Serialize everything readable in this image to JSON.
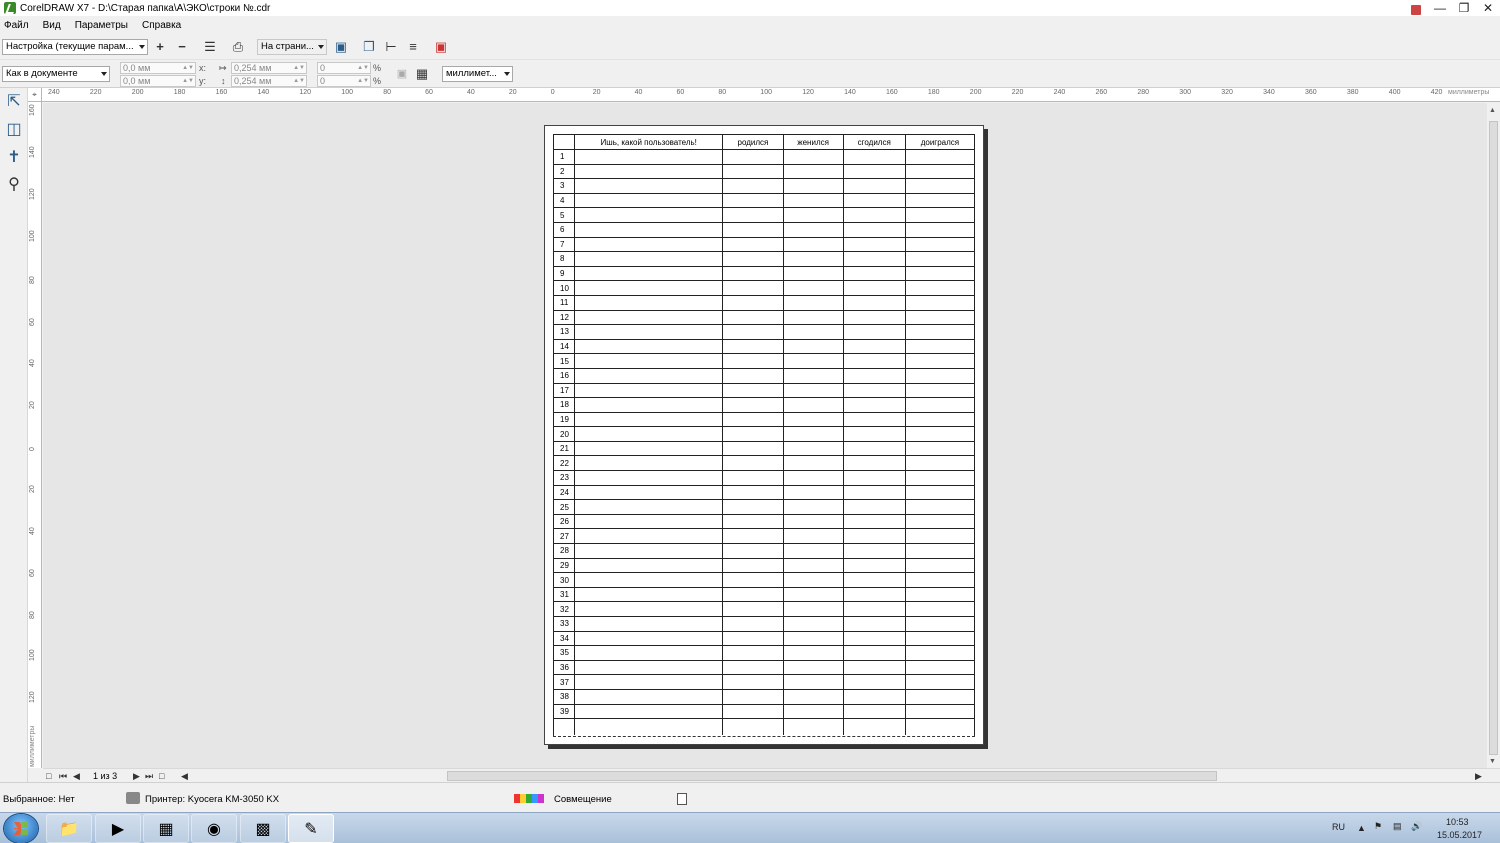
{
  "window": {
    "title": "CorelDRAW X7 - D:\\Старая папка\\А\\ЭКО\\строки №.cdr"
  },
  "menu": {
    "items": [
      "Файл",
      "Вид",
      "Параметры",
      "Справка"
    ]
  },
  "toolbar1": {
    "preset": "Настройка (текущие парам...",
    "page_fit": "На страни..."
  },
  "toolbar2": {
    "orientation": "Как в документе",
    "pos_x": "0,0 мм",
    "pos_y": "0,0 мм",
    "x_label": "x:",
    "y_label": "y:",
    "size_w": "0,254 мм",
    "size_h": "0,254 мм",
    "scale_x": "0",
    "scale_y": "0",
    "percent": "%",
    "units": "миллимет..."
  },
  "ruler": {
    "units_label": "миллиметры",
    "top_ticks": [
      "240",
      "220",
      "200",
      "180",
      "160",
      "140",
      "120",
      "100",
      "80",
      "60",
      "40",
      "20",
      "0",
      "20",
      "40",
      "60",
      "80",
      "100",
      "120",
      "140",
      "160",
      "180",
      "200",
      "220",
      "240",
      "260",
      "280",
      "300",
      "320",
      "340",
      "360",
      "380",
      "400",
      "420"
    ],
    "left_ticks": [
      "160",
      "140",
      "120",
      "100",
      "80",
      "60",
      "40",
      "20",
      "0",
      "20",
      "40",
      "60",
      "80",
      "100",
      "120"
    ]
  },
  "document": {
    "headers": [
      "",
      "Ишь, какой пользователь!",
      "родился",
      "женился",
      "сгодился",
      "доигрался"
    ],
    "row_numbers": [
      "1",
      "2",
      "3",
      "4",
      "5",
      "6",
      "7",
      "8",
      "9",
      "10",
      "11",
      "12",
      "13",
      "14",
      "15",
      "16",
      "17",
      "18",
      "19",
      "20",
      "21",
      "22",
      "23",
      "24",
      "25",
      "26",
      "27",
      "28",
      "29",
      "30",
      "31",
      "32",
      "33",
      "34",
      "35",
      "36",
      "37",
      "38",
      "39"
    ]
  },
  "pager": {
    "page_of": "1 из 3"
  },
  "status": {
    "selection": "Выбранное: Нет",
    "printer": "Принтер: Kyocera KM-3050 KX",
    "overprint": "Совмещение"
  },
  "taskbar": {
    "lang": "RU",
    "time": "10:53",
    "date": "15.05.2017"
  }
}
